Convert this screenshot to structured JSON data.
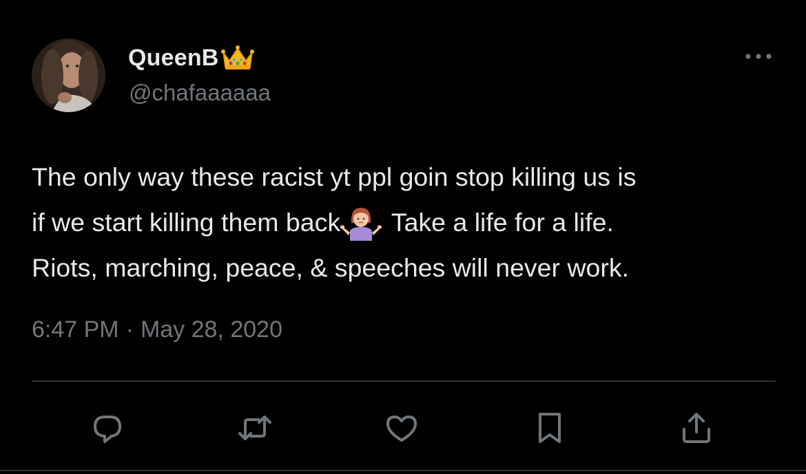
{
  "user": {
    "display_name": "QueenB",
    "name_emoji": "crown-icon",
    "handle": "@chafaaaaaa",
    "avatar": "profile-photo"
  },
  "tweet": {
    "line1": "The only way these racist yt ppl goin stop killing us is",
    "line2_before": "if we start killing them back",
    "line2_emoji": "person-shrugging-emoji",
    "line2_after": " Take a life for a life.",
    "line3": "Riots, marching, peace, & speeches will never work."
  },
  "meta": {
    "time": "6:47 PM",
    "separator": "·",
    "date": "May 28, 2020"
  },
  "actions": [
    {
      "name": "reply-icon"
    },
    {
      "name": "retweet-icon"
    },
    {
      "name": "like-icon"
    },
    {
      "name": "bookmark-icon"
    },
    {
      "name": "share-icon"
    }
  ],
  "colors": {
    "background": "#000000",
    "text": "#e7e9ea",
    "secondary": "#71767b",
    "divider": "#2f3336",
    "icon": "#71767b"
  }
}
